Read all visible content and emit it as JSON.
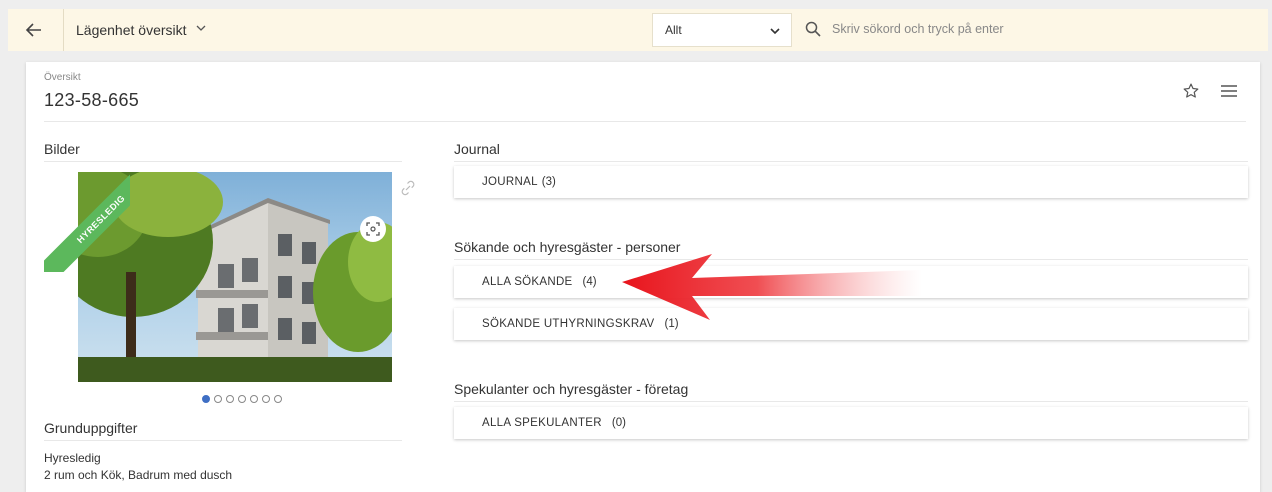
{
  "header": {
    "title": "Lägenhet översikt",
    "filter_value": "Allt",
    "search_placeholder": "Skriv sökord och tryck på enter",
    "back_icon": "arrow-left-icon"
  },
  "overview": {
    "label": "Översikt",
    "id": "123-58-665"
  },
  "images": {
    "title": "Bilder",
    "ribbon": "HYRESLEDIG",
    "image_count": 7,
    "active_index": 0
  },
  "basic_info": {
    "title": "Grunduppgifter",
    "status": "Hyresledig",
    "description": "2 rum och Kök, Badrum med dusch"
  },
  "journal": {
    "title": "Journal",
    "button": {
      "label": "JOURNAL",
      "count": "(3)"
    }
  },
  "persons": {
    "title": "Sökande och hyresgäster - personer",
    "buttons": [
      {
        "label": "ALLA SÖKANDE",
        "count": "(4)"
      },
      {
        "label": "SÖKANDE UTHYRNINGSKRAV",
        "count": "(1)"
      }
    ]
  },
  "companies": {
    "title": "Spekulanter och hyresgäster - företag",
    "buttons": [
      {
        "label": "ALLA SPEKULANTER",
        "count": "(0)"
      }
    ]
  },
  "colors": {
    "topbar_bg": "#fdf7e6",
    "ribbon": "#5cb85c",
    "arrow": "#e8141c",
    "dot_active": "#3f6fc4"
  }
}
